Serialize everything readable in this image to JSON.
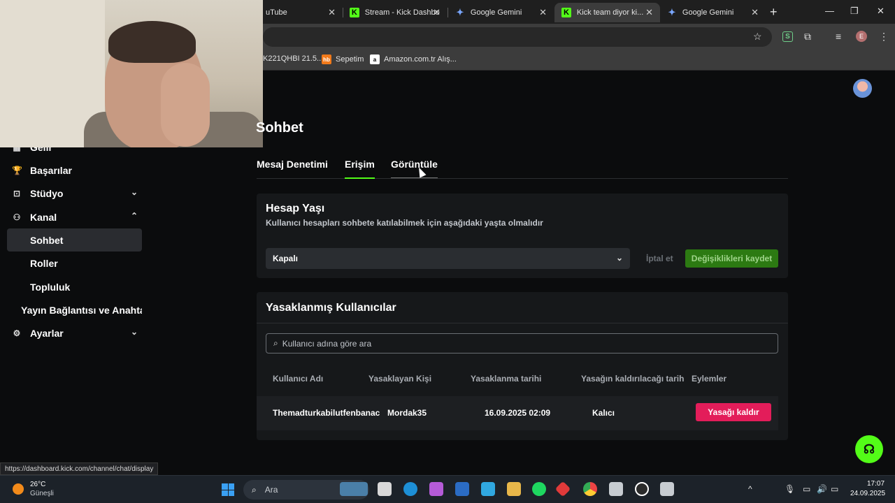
{
  "browser": {
    "tabs": [
      {
        "title": "uTube",
        "favicon": "youtube-icon",
        "active": false
      },
      {
        "title": "Stream - Kick Dashbo",
        "favicon": "kick-icon",
        "active": false
      },
      {
        "title": "Google Gemini",
        "favicon": "gemini-icon",
        "active": false
      },
      {
        "title": "Kick team diyor ki...",
        "favicon": "kick-icon",
        "active": true
      },
      {
        "title": "Google Gemini",
        "favicon": "gemini-icon",
        "active": false
      }
    ],
    "close_glyph": "✕",
    "new_tab_glyph": "+",
    "window_controls": {
      "minimize": "—",
      "restore": "❐",
      "close": "✕"
    },
    "toolbar_icons": {
      "star": "☆",
      "extensions": "⧉",
      "media": "≡",
      "menu": "⋮",
      "ext_s": "S",
      "profile_initial": "E"
    },
    "bookmarks": [
      {
        "label": "K221QHBI 21.5...",
        "favicon": "bookmark-icon"
      },
      {
        "label": "Sepetim",
        "favicon": "hb-icon",
        "fav_text": "hb",
        "color": "#f27a1a"
      },
      {
        "label": "Amazon.com.tr Alış...",
        "favicon": "amazon-icon",
        "fav_text": "a",
        "color": "#ffffff"
      }
    ],
    "status_url": "https://dashboard.kick.com/channel/chat/display"
  },
  "sidebar": {
    "items": [
      {
        "label": "Gelir",
        "icon": "▦",
        "icon_name": "revenue-icon",
        "chevron": ""
      },
      {
        "label": "Başarılar",
        "icon": "🏆",
        "icon_name": "trophy-icon",
        "chevron": ""
      },
      {
        "label": "Stüdyo",
        "icon": "⊡",
        "icon_name": "studio-icon",
        "chevron": "⌄"
      },
      {
        "label": "Kanal",
        "icon": "⚇",
        "icon_name": "channel-icon",
        "chevron": "⌃"
      },
      {
        "label": "Sohbet",
        "active": true
      },
      {
        "label": "Roller"
      },
      {
        "label": "Topluluk"
      },
      {
        "label": "Yayın Bağlantısı ve Anahtarı"
      },
      {
        "label": "Ayarlar",
        "icon": "⚙",
        "icon_name": "gear-icon",
        "chevron": "⌄"
      }
    ]
  },
  "page": {
    "title": "Sohbet",
    "tabs": [
      {
        "label": "Mesaj Denetimi",
        "state": "normal"
      },
      {
        "label": "Erişim",
        "state": "active"
      },
      {
        "label": "Görüntüle",
        "state": "hover"
      }
    ]
  },
  "account_age": {
    "title": "Hesap Yaşı",
    "subtitle": "Kullanıcı hesapları sohbete katılabilmek için aşağıdaki yaşta olmalıdır",
    "selected": "Kapalı",
    "cancel_label": "İptal et",
    "save_label": "Değişiklikleri kaydet"
  },
  "banned": {
    "title": "Yasaklanmış Kullanıcılar",
    "search_placeholder": "Kullanıcı adına göre ara",
    "columns": [
      "Kullanıcı Adı",
      "Yasaklayan Kişi",
      "Yasaklanma tarihi",
      "Yasağın kaldırılacağı tarih",
      "Eylemler"
    ],
    "rows": [
      {
        "username": "Themadturkabilutfenbanac",
        "banned_by": "Mordak35",
        "banned_at": "16.09.2025 02:09",
        "unban_at": "Kalıcı",
        "action": "Yasağı kaldır"
      }
    ]
  },
  "colors": {
    "accent": "#53fc18",
    "danger": "#e31d5a",
    "save_bg": "#2c7a12"
  },
  "taskbar": {
    "weather_temp": "26°C",
    "weather_cond": "Güneşli",
    "search_label": "Ara",
    "time": "17:07",
    "date": "24.09.2025",
    "tray": {
      "chevron": "^",
      "mic": "🎙",
      "monitor": "▭",
      "volume": "🔊",
      "battery": "▭"
    }
  }
}
